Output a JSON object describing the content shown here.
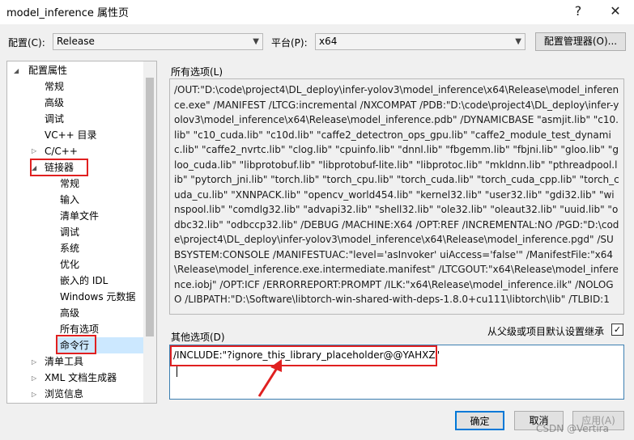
{
  "window": {
    "title": "model_inference 属性页",
    "help": "?",
    "close": "✕"
  },
  "config": {
    "label": "配置(C):",
    "value": "Release"
  },
  "platform": {
    "label": "平台(P):",
    "value": "x64"
  },
  "config_manager_label": "配置管理器(O)...",
  "tree": {
    "root": "配置属性",
    "items": [
      "常规",
      "高级",
      "调试",
      "VC++ 目录",
      "C/C++",
      "链接器",
      "常规",
      "输入",
      "清单文件",
      "调试",
      "系统",
      "优化",
      "嵌入的 IDL",
      "Windows 元数据",
      "高级",
      "所有选项",
      "命令行",
      "清单工具",
      "XML 文档生成器",
      "浏览信息"
    ]
  },
  "all_options": {
    "label": "所有选项(L)",
    "text": "/OUT:\"D:\\code\\project4\\DL_deploy\\infer-yolov3\\model_inference\\x64\\Release\\model_inference.exe\" /MANIFEST /LTCG:incremental /NXCOMPAT /PDB:\"D:\\code\\project4\\DL_deploy\\infer-yolov3\\model_inference\\x64\\Release\\model_inference.pdb\" /DYNAMICBASE \"asmjit.lib\" \"c10.lib\" \"c10_cuda.lib\" \"c10d.lib\" \"caffe2_detectron_ops_gpu.lib\" \"caffe2_module_test_dynamic.lib\" \"caffe2_nvrtc.lib\" \"clog.lib\" \"cpuinfo.lib\" \"dnnl.lib\" \"fbgemm.lib\" \"fbjni.lib\" \"gloo.lib\" \"gloo_cuda.lib\" \"libprotobuf.lib\" \"libprotobuf-lite.lib\" \"libprotoc.lib\" \"mkldnn.lib\" \"pthreadpool.lib\" \"pytorch_jni.lib\" \"torch.lib\" \"torch_cpu.lib\" \"torch_cuda.lib\" \"torch_cuda_cpp.lib\" \"torch_cuda_cu.lib\" \"XNNPACK.lib\" \"opencv_world454.lib\" \"kernel32.lib\" \"user32.lib\" \"gdi32.lib\" \"winspool.lib\" \"comdlg32.lib\" \"advapi32.lib\" \"shell32.lib\" \"ole32.lib\" \"oleaut32.lib\" \"uuid.lib\" \"odbc32.lib\" \"odbccp32.lib\" /DEBUG /MACHINE:X64 /OPT:REF /INCREMENTAL:NO /PGD:\"D:\\code\\project4\\DL_deploy\\infer-yolov3\\model_inference\\x64\\Release\\model_inference.pgd\" /SUBSYSTEM:CONSOLE /MANIFESTUAC:\"level='asInvoker' uiAccess='false'\" /ManifestFile:\"x64\\Release\\model_inference.exe.intermediate.manifest\" /LTCGOUT:\"x64\\Release\\model_inference.iobj\" /OPT:ICF /ERRORREPORT:PROMPT /ILK:\"x64\\Release\\model_inference.ilk\" /NOLOGO /LIBPATH:\"D:\\Software\\libtorch-win-shared-with-deps-1.8.0+cu111\\libtorch\\lib\" /TLBID:1"
  },
  "inherit": {
    "label": "从父级或项目默认设置继承",
    "checked": true
  },
  "other_options": {
    "label": "其他选项(D)",
    "value": "/INCLUDE:\"?ignore_this_library_placeholder@@YAHXZ\""
  },
  "buttons": {
    "ok": "确定",
    "cancel": "取消",
    "apply": "应用(A)"
  },
  "watermark": "CSDN @Vertira",
  "colors": {
    "highlight": "#cce8ff",
    "annotation": "#e02020"
  }
}
